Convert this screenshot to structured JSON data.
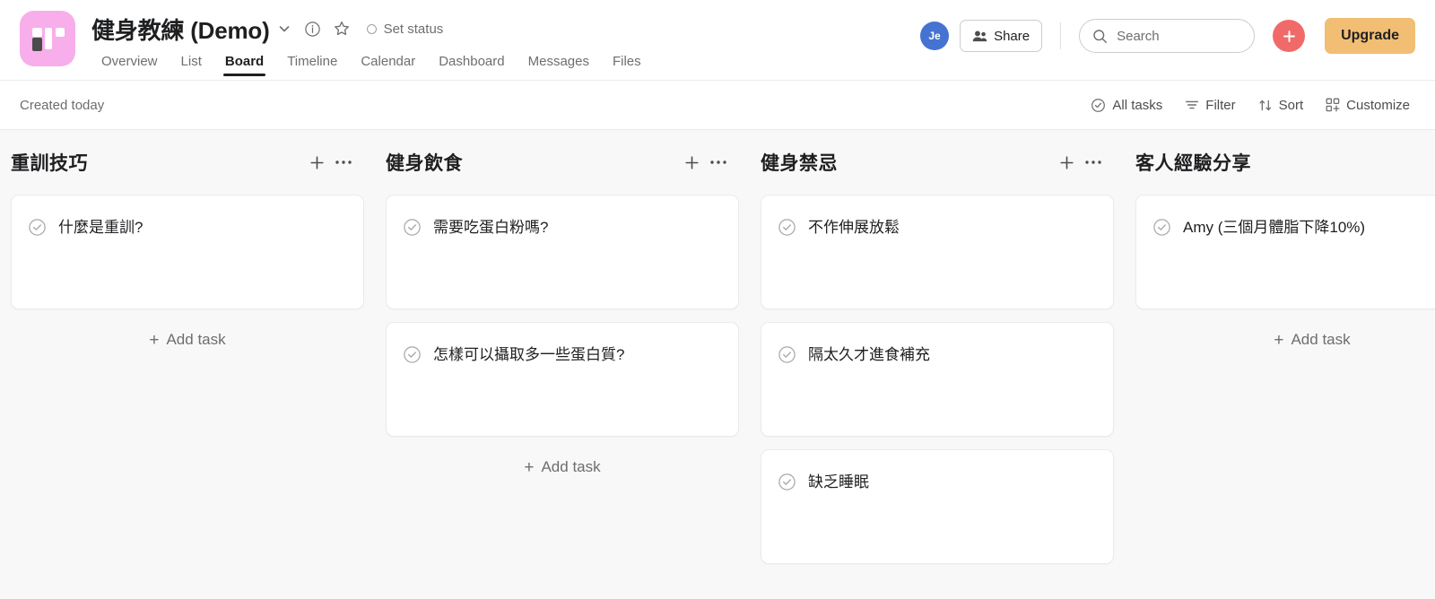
{
  "header": {
    "project_title": "健身教練 (Demo)",
    "project_icon_name": "board-project-icon",
    "icons": {
      "chevron": "chevron-down-icon",
      "info": "info-circle-icon",
      "star": "star-outline-icon"
    },
    "set_status_label": "Set status",
    "tabs": [
      {
        "label": "Overview",
        "active": false
      },
      {
        "label": "List",
        "active": false
      },
      {
        "label": "Board",
        "active": true
      },
      {
        "label": "Timeline",
        "active": false
      },
      {
        "label": "Calendar",
        "active": false
      },
      {
        "label": "Dashboard",
        "active": false
      },
      {
        "label": "Messages",
        "active": false
      },
      {
        "label": "Files",
        "active": false
      }
    ],
    "avatar_initials": "Je",
    "share_label": "Share",
    "search_placeholder": "Search",
    "plus_label": "+",
    "upgrade_label": "Upgrade"
  },
  "toolbar": {
    "created_text": "Created today",
    "all_tasks_label": "All tasks",
    "filter_label": "Filter",
    "sort_label": "Sort",
    "customize_label": "Customize"
  },
  "board": {
    "add_task_label": "Add task",
    "columns": [
      {
        "title": "重訓技巧",
        "show_actions": true,
        "show_add_task": true,
        "cards": [
          {
            "title": "什麼是重訓?"
          }
        ]
      },
      {
        "title": "健身飲食",
        "show_actions": true,
        "show_add_task": true,
        "cards": [
          {
            "title": "需要吃蛋白粉嗎?"
          },
          {
            "title": "怎樣可以攝取多一些蛋白質?"
          }
        ]
      },
      {
        "title": "健身禁忌",
        "show_actions": true,
        "show_add_task": false,
        "cards": [
          {
            "title": "不作伸展放鬆"
          },
          {
            "title": "隔太久才進食補充"
          },
          {
            "title": "缺乏睡眠"
          }
        ]
      },
      {
        "title": "客人經驗分享",
        "show_actions": false,
        "show_add_task": true,
        "cards": [
          {
            "title": "Amy (三個月體脂下降10%)"
          }
        ]
      }
    ]
  },
  "colors": {
    "accent_red": "#F06A6A",
    "upgrade_orange": "#F1BE73",
    "avatar_blue": "#4573D2",
    "project_pink": "#F7AEEA",
    "board_bg": "#f9f8f8"
  }
}
